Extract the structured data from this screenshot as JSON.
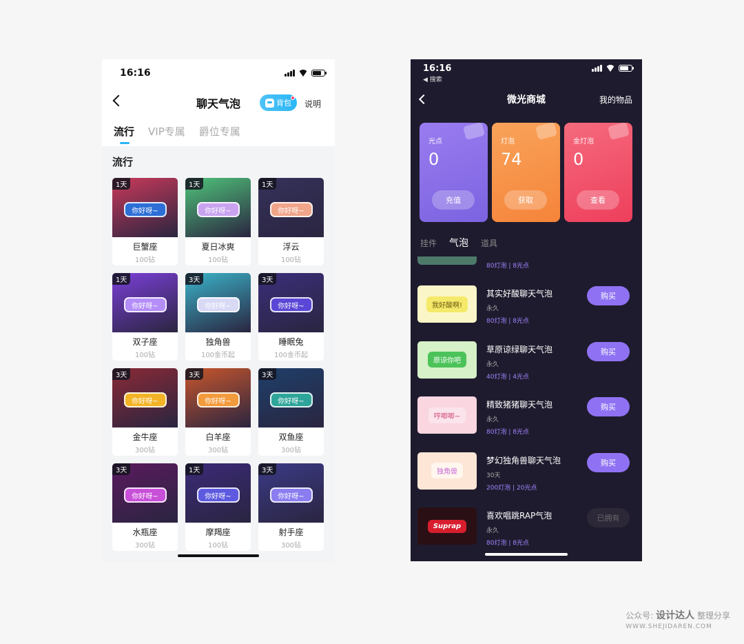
{
  "left": {
    "status": {
      "time": "16:16"
    },
    "title": "聊天气泡",
    "bag_label": "背包",
    "help_label": "说明",
    "tabs": [
      {
        "label": "流行"
      },
      {
        "label": "VIP专属"
      },
      {
        "label": "爵位专属"
      }
    ],
    "section_title": "流行",
    "items": [
      {
        "days": "1天",
        "bubble": "你好呀~",
        "name": "巨蟹座",
        "price": "100钻",
        "bg": "#c9395a",
        "bubble_color": "#2d6fd6"
      },
      {
        "days": "1天",
        "bubble": "你好呀~",
        "name": "夏日冰爽",
        "price": "100钻",
        "bg": "#4fc37a",
        "bubble_color": "#c9a3f0"
      },
      {
        "days": "1天",
        "bubble": "你好呀~",
        "name": "浮云",
        "price": "100钻",
        "bg": "#35315a",
        "bubble_color": "#f0a58a"
      },
      {
        "days": "1天",
        "bubble": "你好呀~",
        "name": "双子座",
        "price": "100钻",
        "bg": "#7b3fd8",
        "bubble_color": "#b48ef7"
      },
      {
        "days": "3天",
        "bubble": "你好呀~",
        "name": "独角兽",
        "price": "100金币起",
        "bg": "#3ab3c9",
        "bubble_color": "#d7d9f5"
      },
      {
        "days": "3天",
        "bubble": "你好呀~",
        "name": "睡眠兔",
        "price": "100金币起",
        "bg": "#3b2e7a",
        "bubble_color": "#5a47d6"
      },
      {
        "days": "3天",
        "bubble": "你好呀~",
        "name": "金牛座",
        "price": "300钻",
        "bg": "#8a2a36",
        "bubble_color": "#f3b326"
      },
      {
        "days": "3天",
        "bubble": "你好呀~",
        "name": "白羊座",
        "price": "300钻",
        "bg": "#c8562c",
        "bubble_color": "#f39a3c"
      },
      {
        "days": "3天",
        "bubble": "你好呀~",
        "name": "双鱼座",
        "price": "300钻",
        "bg": "#1e3f6a",
        "bubble_color": "#2fa59a"
      },
      {
        "days": "3天",
        "bubble": "你好呀~",
        "name": "水瓶座",
        "price": "300钻",
        "bg": "#5a1a5e",
        "bubble_color": "#c84fd8"
      },
      {
        "days": "1天",
        "bubble": "你好呀~",
        "name": "摩羯座",
        "price": "100钻",
        "bg": "#3b2a78",
        "bubble_color": "#5d5ae0"
      },
      {
        "days": "3天",
        "bubble": "你好呀~",
        "name": "射手座",
        "price": "300钻",
        "bg": "#3b3a86",
        "bubble_color": "#8a7df0"
      }
    ]
  },
  "right": {
    "status": {
      "time": "16:16",
      "back_app": "◀ 搜索"
    },
    "title": "微光商城",
    "mine_label": "我的物品",
    "cards": [
      {
        "label": "光点",
        "value": "0",
        "button": "充值",
        "color": "#7b63e0",
        "color2": "#9a7cf0"
      },
      {
        "label": "灯泡",
        "value": "74",
        "button": "获取",
        "color": "#f5843a",
        "color2": "#f9a35a"
      },
      {
        "label": "金灯泡",
        "value": "0",
        "button": "查看",
        "color": "#ee3f5d",
        "color2": "#f56a7c"
      }
    ],
    "tabs": [
      {
        "label": "挂件"
      },
      {
        "label": "气泡"
      },
      {
        "label": "道具"
      }
    ],
    "partial_price": "80灯泡 | 8光点",
    "items": [
      {
        "name": "其实好酸聊天气泡",
        "duration": "永久",
        "price": "80灯泡 | 8光点",
        "thumb_text": "我好酸啊!",
        "thumb_bg": "#fbf6c8",
        "bubble_bg": "#f5e96a",
        "bubble_fg": "#6b5a10",
        "button": "购买",
        "owned": false
      },
      {
        "name": "草原谅绿聊天气泡",
        "duration": "永久",
        "price": "40灯泡 | 4光点",
        "thumb_text": "原谅你吧",
        "thumb_bg": "#d6f0c8",
        "bubble_bg": "#4cc35a",
        "bubble_fg": "#ffffff",
        "button": "购买",
        "owned": false
      },
      {
        "name": "精致猪猪聊天气泡",
        "duration": "永久",
        "price": "80灯泡 | 8光点",
        "thumb_text": "哼唧唧~",
        "thumb_bg": "#f9d6e0",
        "bubble_bg": "#fbe4ec",
        "bubble_fg": "#d24d7a",
        "button": "购买",
        "owned": false
      },
      {
        "name": "梦幻独角兽聊天气泡",
        "duration": "30天",
        "price": "200灯泡 | 20光点",
        "thumb_text": "独角兽",
        "thumb_bg": "#fde6d6",
        "bubble_bg": "#fff6ee",
        "bubble_fg": "#c86ad8",
        "button": "购买",
        "owned": false
      },
      {
        "name": "喜欢唱跳RAP气泡",
        "duration": "永久",
        "price": "80灯泡 | 8光点",
        "thumb_text": "Suprap",
        "thumb_bg": "#2a1014",
        "bubble_bg": "#d81e2e",
        "bubble_fg": "#ffffff",
        "button": "已拥有",
        "owned": true
      }
    ]
  },
  "watermark": {
    "prefix": "公众号:",
    "brand": "设计达人",
    "suffix": "整理分享",
    "url": "WWW.SHEJIDAREN.COM"
  }
}
